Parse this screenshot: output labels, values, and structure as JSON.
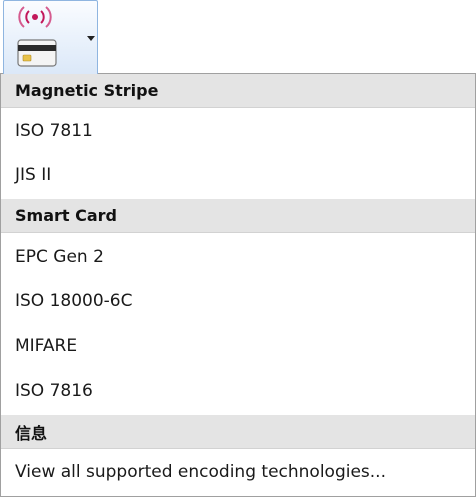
{
  "toolbar": {
    "encoding_button": {
      "icon": "rfid-card-icon",
      "arrow_icon": "chevron-down-icon"
    }
  },
  "menu": {
    "sections": [
      {
        "header": "Magnetic Stripe",
        "items": [
          "ISO 7811",
          "JIS II"
        ]
      },
      {
        "header": "Smart Card",
        "items": [
          "EPC Gen 2",
          "ISO 18000-6C",
          "MIFARE",
          "ISO 7816"
        ]
      },
      {
        "header": "信息",
        "items": [
          "View all supported encoding technologies..."
        ]
      }
    ]
  },
  "colors": {
    "header_background": "#e4e4e4",
    "rfid_wave": "#c2185b",
    "button_border": "#8fb5e0"
  }
}
